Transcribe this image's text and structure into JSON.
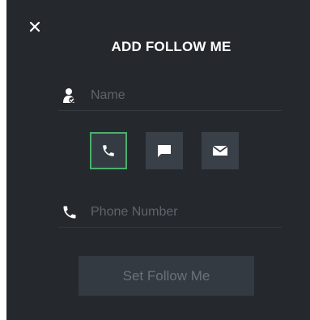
{
  "dialog": {
    "title": "ADD FOLLOW ME",
    "close_icon": "close-icon"
  },
  "name_field": {
    "icon": "person-icon",
    "placeholder": "Name",
    "value": ""
  },
  "contact_types": [
    {
      "icon": "phone-icon",
      "selected": true
    },
    {
      "icon": "chat-icon",
      "selected": false
    },
    {
      "icon": "mail-icon",
      "selected": false
    }
  ],
  "phone_field": {
    "icon": "phone-icon",
    "placeholder": "Phone Number",
    "value": ""
  },
  "submit": {
    "label": "Set Follow Me",
    "enabled": false
  },
  "colors": {
    "background": "#25292e",
    "accent_selected": "#4caf6e",
    "button_bg": "#3a4048",
    "placeholder_text": "#5f656c"
  }
}
